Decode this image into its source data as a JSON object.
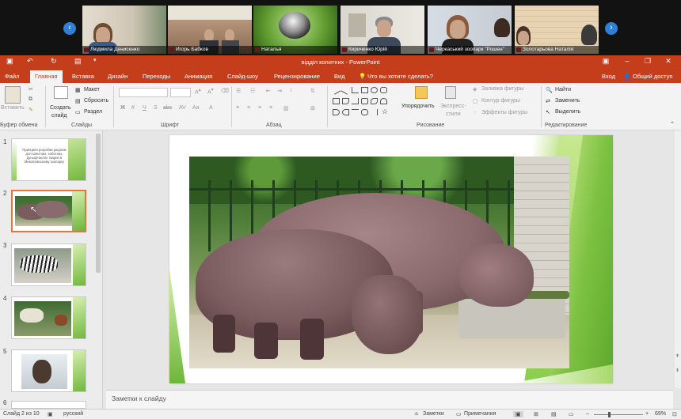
{
  "participants": [
    {
      "name": "Людмила Денисенко"
    },
    {
      "name": "Игорь Бабков"
    },
    {
      "name": "Наталья"
    },
    {
      "name": "Кириченко Юрій"
    },
    {
      "name": "Черкаський зоопарк \"Рошен\""
    },
    {
      "name": "Золотарьова Наталія"
    }
  ],
  "window": {
    "title": "відділ копитних - PowerPoint"
  },
  "tabs": [
    "Файл",
    "Главная",
    "Вставка",
    "Дизайн",
    "Переходы",
    "Анимация",
    "Слайд-шоу",
    "Рецензирование",
    "Вид"
  ],
  "tell_me": "Что вы хотите сделать?",
  "account": {
    "login": "Вход",
    "share": "Общий доступ"
  },
  "ribbon": {
    "paste": "Вставить",
    "new_slide_1": "Создать",
    "new_slide_2": "слайд",
    "layout": "Макет",
    "reset": "Сбросить",
    "section": "Раздел",
    "arrange": "Упорядочить",
    "quick_1": "Экспресс-",
    "quick_2": "стили",
    "fill": "Заливка фигуры",
    "outline": "Контур фигуры",
    "effects": "Эффекты фигуры",
    "find": "Найти",
    "replace": "Заменить",
    "select": "Выделить",
    "font_b": "Ж",
    "font_i": "К",
    "font_u": "Ч",
    "font_s": "S",
    "font_abc": "abc",
    "groups": {
      "clipboard": "Буфер обмена",
      "slides": "Слайды",
      "font": "Шрифт",
      "paragraph": "Абзац",
      "drawing": "Рисование",
      "editing": "Редактирование"
    }
  },
  "slides": [
    {
      "num": "1",
      "caption": "Принципи розробки рацiонiв для копитних, хоботних, дуньорчастих тварин в Миколаївському зоопарку"
    },
    {
      "num": "2"
    },
    {
      "num": "3"
    },
    {
      "num": "4"
    },
    {
      "num": "5"
    },
    {
      "num": "6"
    }
  ],
  "notes_placeholder": "Заметки к слайду",
  "status": {
    "slide": "Слайд 2 из 10",
    "language": "русский",
    "notes": "Заметки",
    "comments": "Примечания",
    "zoom": "69%"
  },
  "colors": {
    "accent": "#c43e1c",
    "green": "#7dc242",
    "selected_border": "#e8743b"
  }
}
